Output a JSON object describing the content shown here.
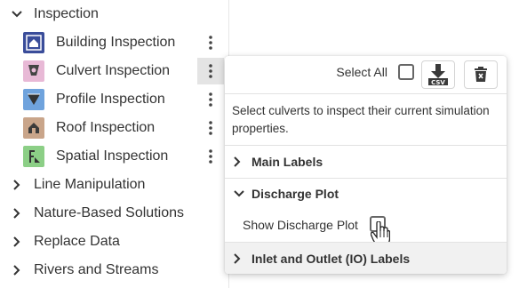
{
  "tree": {
    "group_inspection": "Inspection",
    "tools": [
      {
        "label": "Building Inspection",
        "icon": "building-icon",
        "color": "#3a4d9a"
      },
      {
        "label": "Culvert Inspection",
        "icon": "culvert-icon",
        "color": "#e8b9d6"
      },
      {
        "label": "Profile Inspection",
        "icon": "profile-icon",
        "color": "#6fa3dd"
      },
      {
        "label": "Roof Inspection",
        "icon": "roof-icon",
        "color": "#c9a58a"
      },
      {
        "label": "Spatial Inspection",
        "icon": "spatial-icon",
        "color": "#8ccf86"
      }
    ],
    "groups": [
      "Line Manipulation",
      "Nature-Based Solutions",
      "Replace Data",
      "Rivers and Streams"
    ]
  },
  "popup": {
    "select_all_label": "Select All",
    "csv_label": "CSV",
    "description": "Select culverts to inspect their current simulation properties.",
    "sections": {
      "main_labels": "Main Labels",
      "discharge_plot": "Discharge Plot",
      "show_discharge_plot": "Show Discharge Plot",
      "inlet_outlet": "Inlet and Outlet (IO) Labels"
    }
  },
  "colors": {
    "text": "#333333",
    "active_menu_bg": "#e4e4e4",
    "section_grey": "#f1f1f1"
  }
}
